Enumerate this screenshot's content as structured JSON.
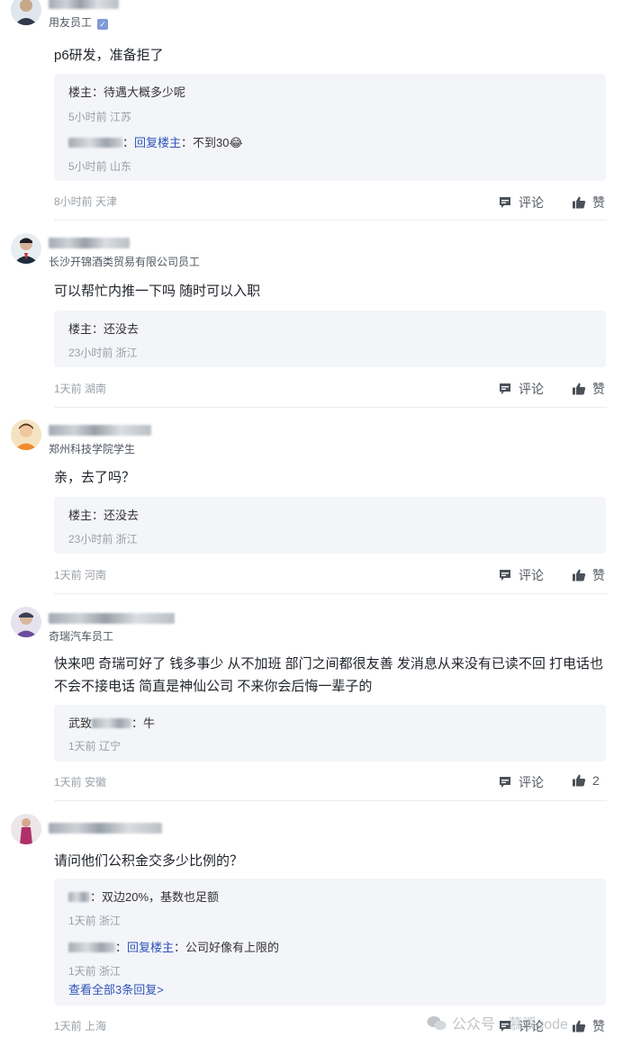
{
  "comments": [
    {
      "org": "用友员工",
      "verified": true,
      "text": "p6研发，准备拒了",
      "replies": [
        {
          "author": "楼主",
          "reply_to": "",
          "text": "待遇大概多少呢",
          "meta": "5小时前 江苏"
        },
        {
          "author": "",
          "reply_to": "回复楼主",
          "text": "不到30😂",
          "meta": "5小时前 山东"
        }
      ],
      "meta": "8小时前 天津",
      "comment_label": "评论",
      "like_label": "赞"
    },
    {
      "org": "长沙开锦酒类贸易有限公司员工",
      "text": "可以帮忙内推一下吗 随时可以入职",
      "replies": [
        {
          "author": "楼主",
          "reply_to": "",
          "text": "还没去",
          "meta": "23小时前 浙江"
        }
      ],
      "meta": "1天前 湖南",
      "comment_label": "评论",
      "like_label": "赞"
    },
    {
      "org": "郑州科技学院学生",
      "text": "亲，去了吗？",
      "replies": [
        {
          "author": "楼主",
          "reply_to": "",
          "text": "还没去",
          "meta": "23小时前 浙江"
        }
      ],
      "meta": "1天前 河南",
      "comment_label": "评论",
      "like_label": "赞"
    },
    {
      "org": "奇瑞汽车员工",
      "text": "快来吧 奇瑞可好了 钱多事少 从不加班 部门之间都很友善 发消息从来没有已读不回 打电话也不会不接电话 简直是神仙公司 不来你会后悔一辈子的",
      "replies": [
        {
          "author": "武致",
          "reply_to": "",
          "text": "牛",
          "meta": "1天前 辽宁"
        }
      ],
      "meta": "1天前 安徽",
      "comment_label": "评论",
      "like_label": "2"
    },
    {
      "org": "",
      "text": "请问他们公积金交多少比例的？",
      "replies": [
        {
          "author": "",
          "reply_to": "",
          "text": "双边20%，基数也足额",
          "meta": "1天前 浙江"
        },
        {
          "author": "",
          "reply_to": "回复楼主",
          "text": "公司好像有上限的",
          "meta": "1天前 浙江"
        }
      ],
      "more_replies": "查看全部3条回复>",
      "meta": "1天前 上海",
      "comment_label": "评论",
      "like_label": "赞"
    }
  ],
  "watermark": "公众号 · 慕溪code"
}
